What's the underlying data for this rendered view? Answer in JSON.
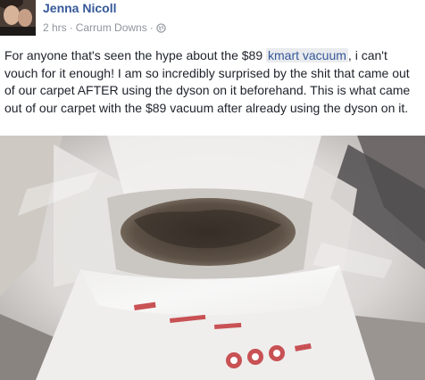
{
  "post": {
    "author": "Jenna Nicoll",
    "time": "2 hrs",
    "separator": "·",
    "location": "Carrum Downs",
    "text_before": "For anyone that's seen the hype about the $89 ",
    "link_text": "kmart vacuum",
    "text_after": ", i can't vouch for it enough! I am so incredibly surprised by the shit that came out of our carpet AFTER using the dyson on it beforehand. This is what came out of our carpet with the $89 vacuum after already using the dyson on it."
  },
  "icons": {
    "audience": "globe-icon"
  },
  "colors": {
    "author": "#365899",
    "meta": "#90949c",
    "text": "#1d2129"
  }
}
